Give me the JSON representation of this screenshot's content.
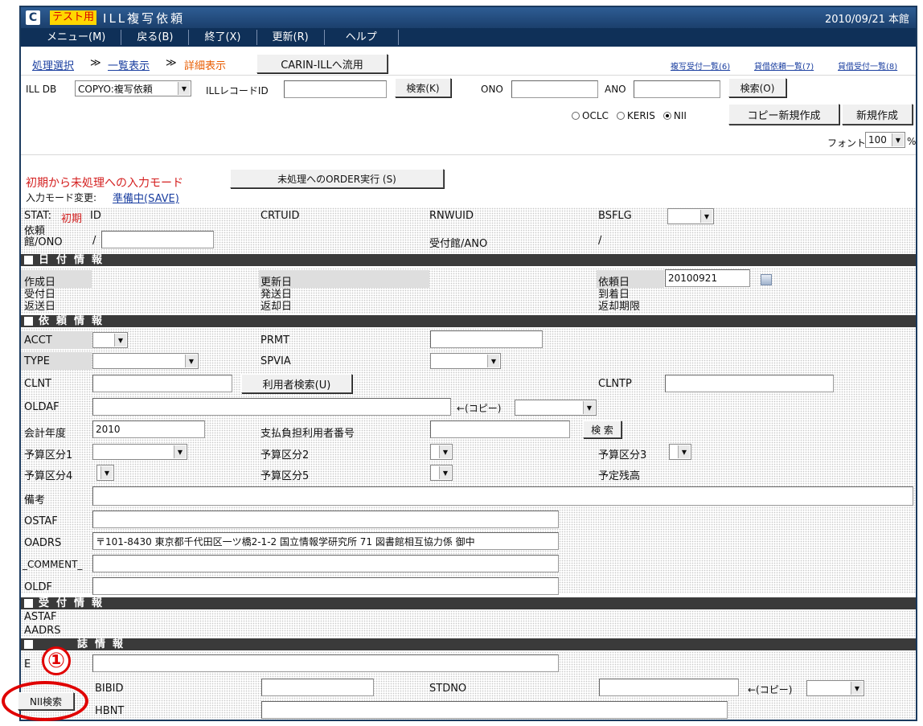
{
  "titlebar": {
    "test_badge": "テスト用",
    "title": "ILL複写依頼",
    "date_branch": "2010/09/21 本館"
  },
  "menu": [
    "メニュー(M)",
    "戻る(B)",
    "終了(X)",
    "更新(R)",
    "ヘルプ"
  ],
  "breadcrumb": {
    "step1": "処理選択",
    "sep": "≫",
    "step2": "一覧表示",
    "step3": "詳細表示"
  },
  "carin_button": "CARIN-ILLへ流用",
  "top_links": [
    "複写受付一覧(6)",
    "貸借依頼一覧(7)",
    "貸借受付一覧(8)"
  ],
  "search_row": {
    "ill_db_label": "ILL DB",
    "ill_db_value": "COPYO:複写依頼",
    "record_id_label": "ILLレコードID",
    "search_k": "検索(K)",
    "ono_label": "ONO",
    "ano_label": "ANO",
    "search_o": "検索(O)"
  },
  "radios": [
    {
      "label": "OCLC",
      "checked": false
    },
    {
      "label": "KERIS",
      "checked": false
    },
    {
      "label": "NII",
      "checked": true
    }
  ],
  "buttons": {
    "copy_new": "コピー新規作成",
    "new": "新規作成",
    "order": "未処理へのORDER実行 (S)",
    "user_search": "利用者検索(U)",
    "search": "検 索",
    "nii_search": "NII検索"
  },
  "font": {
    "label": "フォント",
    "value": "100",
    "unit": "%"
  },
  "mode": {
    "title": "初期から未処理への入力モード",
    "change_label": "入力モード変更:",
    "change_link": "準備中(SAVE)"
  },
  "stat_row": {
    "stat_label": "STAT:",
    "stat_value": "初期",
    "id": "ID",
    "crtuid": "CRTUID",
    "rnwuid": "RNWUID",
    "bsflg": "BSFLG"
  },
  "req_row": {
    "label": "依頼館/ONO",
    "slash": "/",
    "recv_label": "受付館/ANO",
    "recv_value": "/"
  },
  "sections": {
    "date": "日付情報",
    "request": "依頼情報",
    "receive": "受付情報",
    "journal": "誌情報"
  },
  "dates": {
    "created": "作成日",
    "updated": "更新日",
    "requested": "依頼日",
    "requested_value": "20100921",
    "received": "受付日",
    "sent": "発送日",
    "arrived": "到着日",
    "returned": "返送日",
    "return_recv": "返却日",
    "return_due": "返却期限"
  },
  "request": {
    "acct": "ACCT",
    "prmt": "PRMT",
    "type": "TYPE",
    "spvia": "SPVIA",
    "clnt": "CLNT",
    "clntp": "CLNTP",
    "oldaf": "OLDAF",
    "copy_arrow": "←(コピー)",
    "fiscal_year": "会計年度",
    "fiscal_value": "2010",
    "payer": "支払負担利用者番号",
    "budget1": "予算区分1",
    "budget2": "予算区分2",
    "budget3": "予算区分3",
    "budget4": "予算区分4",
    "budget5": "予算区分5",
    "remaining": "予定残高",
    "notes": "備考",
    "ostaf": "OSTAF",
    "oadrs": "OADRS",
    "oadrs_value": "〒101-8430 東京都千代田区一ツ橋2-1-2 国立情報学研究所 71 図書館相互協力係 御中",
    "comment": "_COMMENT_",
    "oldf": "OLDF"
  },
  "receive": {
    "astaf": "ASTAF",
    "aadrs": "AADRS"
  },
  "journal": {
    "row_label": "E",
    "bibid": "BIBID",
    "stdno": "STDNO",
    "copy_arrow": "←(コピー)",
    "hbnt": "HBNT"
  },
  "annotation": {
    "number": "①"
  },
  "colors": {
    "accent_red": "#e00000",
    "titlebar": "#1b3f6c",
    "link": "#1b3fa0",
    "section": "#3a3a3a"
  }
}
